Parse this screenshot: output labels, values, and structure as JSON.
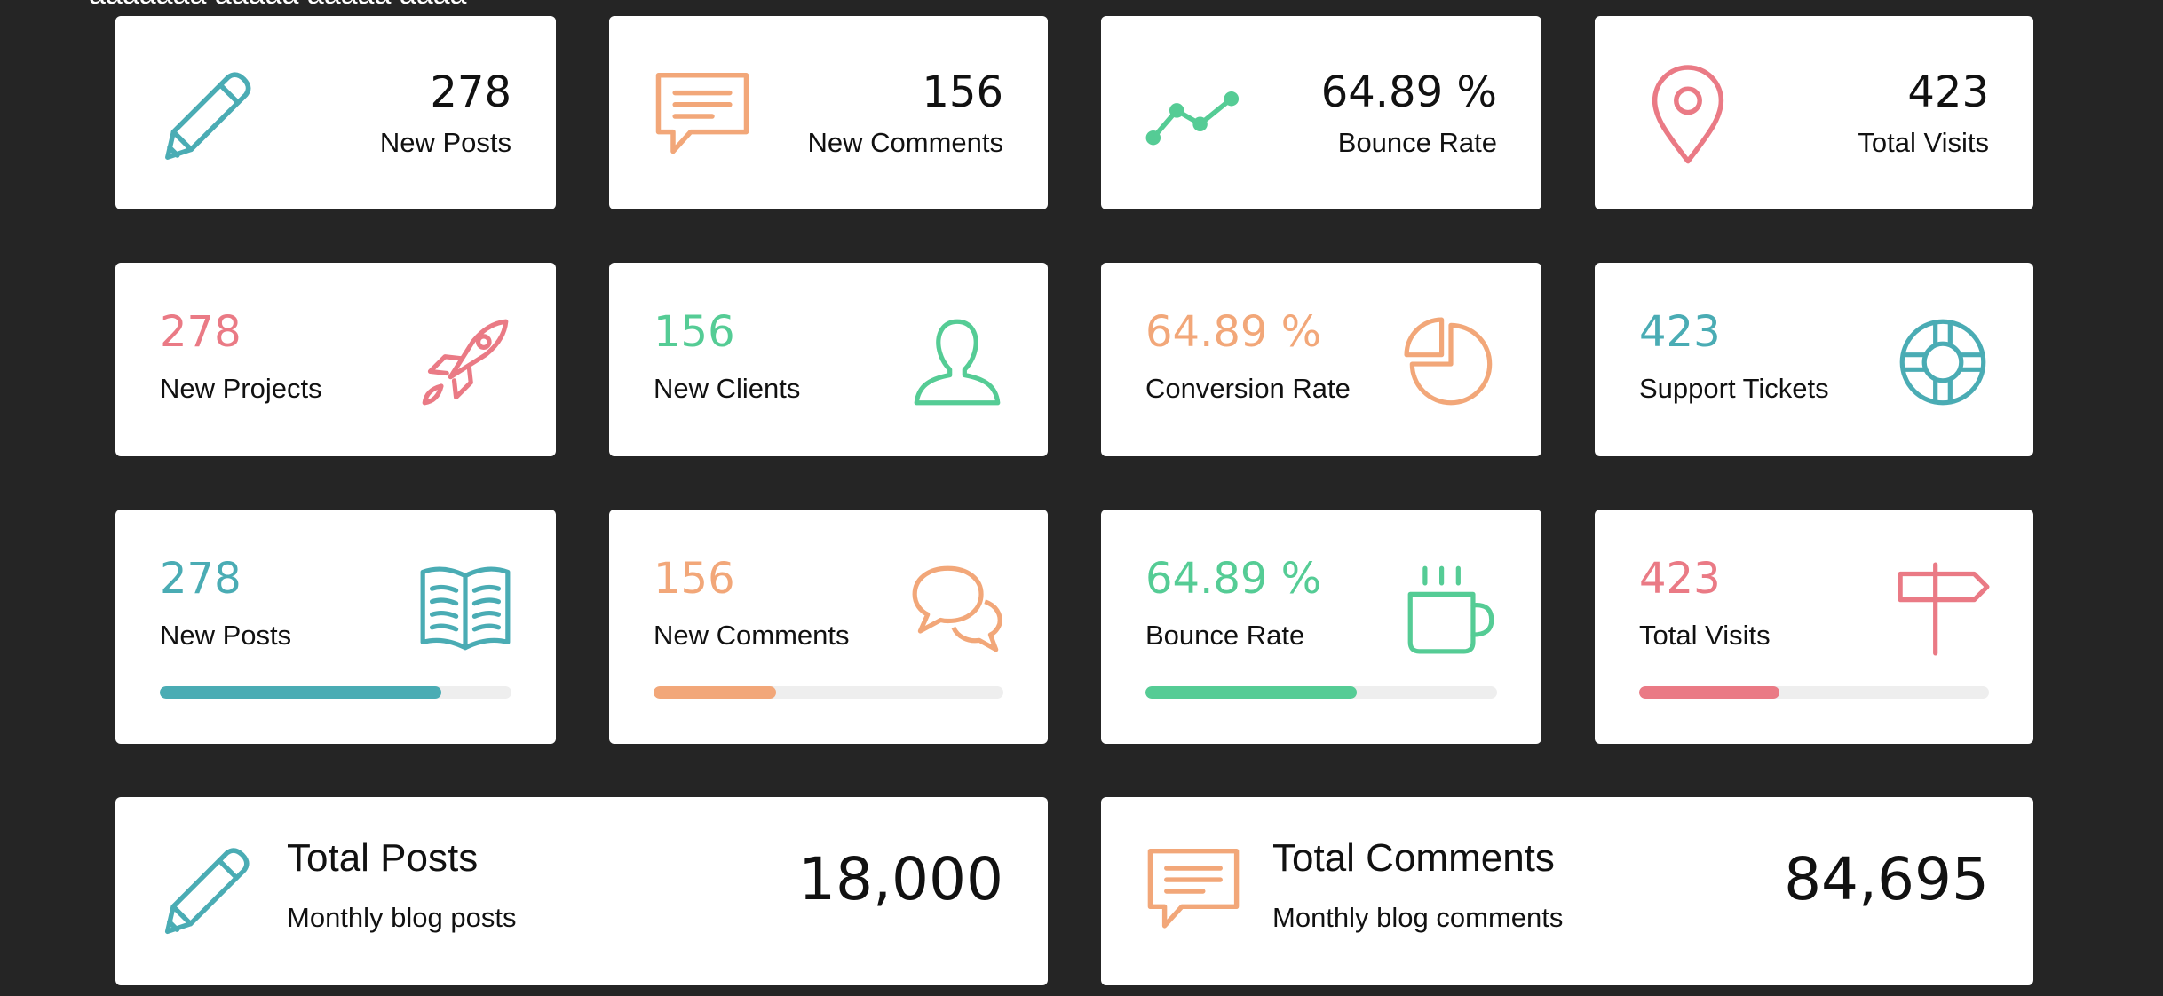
{
  "header": {
    "clipped_title": "aaaaaaa aaaaa aaaaa aaaa"
  },
  "colors": {
    "teal": "#4aacb4",
    "orange": "#f2a779",
    "green": "#55cc95",
    "pink": "#ea7a85"
  },
  "row1": [
    {
      "value": "278",
      "label": "New Posts",
      "icon": "pencil-icon"
    },
    {
      "value": "156",
      "label": "New Comments",
      "icon": "comment-icon"
    },
    {
      "value": "64.89 %",
      "label": "Bounce Rate",
      "icon": "line-chart-icon"
    },
    {
      "value": "423",
      "label": "Total Visits",
      "icon": "map-pin-icon"
    }
  ],
  "row2": [
    {
      "value": "278",
      "label": "New Projects",
      "icon": "rocket-icon"
    },
    {
      "value": "156",
      "label": "New Clients",
      "icon": "user-icon"
    },
    {
      "value": "64.89 %",
      "label": "Conversion Rate",
      "icon": "pie-chart-icon"
    },
    {
      "value": "423",
      "label": "Support Tickets",
      "icon": "lifebuoy-icon"
    }
  ],
  "row3": [
    {
      "value": "278",
      "label": "New Posts",
      "icon": "book-icon",
      "progress": 0.8
    },
    {
      "value": "156",
      "label": "New Comments",
      "icon": "chat-bubbles-icon",
      "progress": 0.35
    },
    {
      "value": "64.89 %",
      "label": "Bounce Rate",
      "icon": "coffee-mug-icon",
      "progress": 0.6
    },
    {
      "value": "423",
      "label": "Total Visits",
      "icon": "signpost-icon",
      "progress": 0.4
    }
  ],
  "row4": [
    {
      "title": "Total Posts",
      "subtitle": "Monthly blog posts",
      "value": "18,000",
      "icon": "pencil-icon"
    },
    {
      "title": "Total Comments",
      "subtitle": "Monthly blog comments",
      "value": "84,695",
      "icon": "comment-icon"
    }
  ]
}
